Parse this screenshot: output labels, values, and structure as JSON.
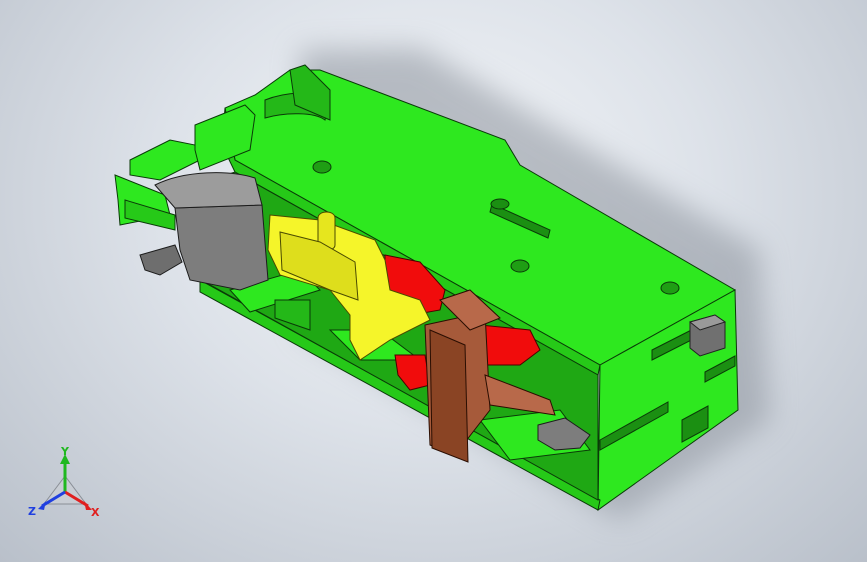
{
  "view": {
    "background_top": "#f4f6f9",
    "background_bottom": "#b9c0ca"
  },
  "model": {
    "housing_color": "#2ee81f",
    "housing_shade": "#24b818",
    "lever_color": "#f5f52a",
    "contact_color": "#f10c0c",
    "slider_color": "#a65a3a",
    "cam_color": "#7d7d7d"
  },
  "triad": {
    "y_label": "Y",
    "z_label": "Z",
    "x_label": "X",
    "y_color": "#1fb81f",
    "x_color": "#e01f1f",
    "z_color": "#1f3fe0"
  }
}
